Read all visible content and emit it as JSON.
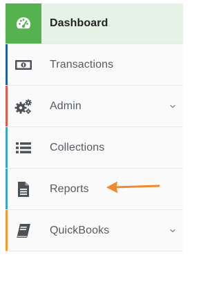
{
  "sidebar": {
    "items": [
      {
        "label": "Dashboard",
        "icon": "dashboard-gauge-icon",
        "active": true,
        "accent": "#55b24f"
      },
      {
        "label": "Transactions",
        "icon": "money-bill-icon",
        "active": false,
        "accent": "#1f5fa8"
      },
      {
        "label": "Admin",
        "icon": "gears-icon",
        "active": false,
        "accent": "#e0584f",
        "has_submenu": true
      },
      {
        "label": "Collections",
        "icon": "list-icon",
        "active": false,
        "accent": "#3aa8c0"
      },
      {
        "label": "Reports",
        "icon": "document-icon",
        "active": false,
        "accent": "#3aa8c0"
      },
      {
        "label": "QuickBooks",
        "icon": "book-icon",
        "active": false,
        "accent": "#f39a35",
        "has_submenu": true
      }
    ]
  },
  "annotation": {
    "arrow_color": "#f08a2c",
    "points_to": "Reports"
  },
  "colors": {
    "active_bg": "#e6f2e6",
    "active_icon_bg": "#55b24f",
    "item_bg": "#fafafa",
    "icon_gray": "#4c5157",
    "text_gray": "#555b62"
  }
}
